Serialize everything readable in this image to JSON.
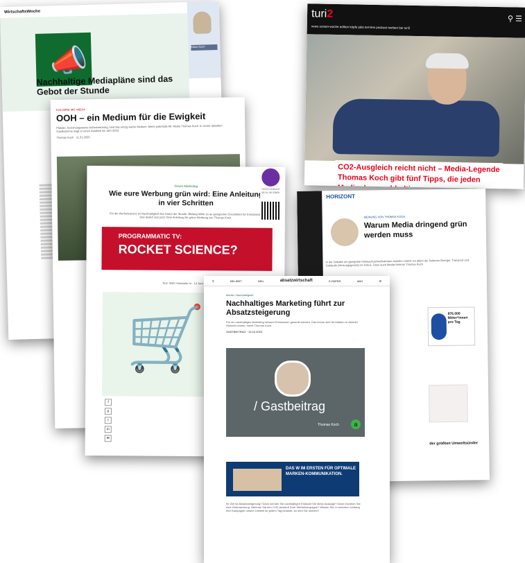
{
  "card_wiwo": {
    "masthead": "WirtschaftsWoche",
    "headline": "Nachhaltige Mediapläne sind das Gebot der Stunde",
    "side_caption": "Klaus Koch"
  },
  "card_turi2": {
    "logo_main": "turi",
    "logo_accent": "2",
    "nav": "news  screen-woche  edition  köpfe  jobs  termine  podcast  werben bei turi2",
    "headline": "CO2-Ausgleich reicht nicht – Media-Legende Thomas Koch gibt fünf Tipps, die jeden Mediaplan nachhaltiger"
  },
  "card_ooh": {
    "kicker": "KOLUMNE MR. MEDIA",
    "headline": "OOH – ein Medium für die Ewigkeit",
    "lead": "Plakate, beziehungsweise Außenwerbung, sind das einzig wahre Medium. Meint jedenfalls Mr. Media Thomas Koch. In seiner aktuellen Gastkolumne wagt er einen Ausblick ins Jahr 2023.",
    "byline": "Thomas Koch · 11.01.2023"
  },
  "card_green": {
    "kicker": "Green Marketing",
    "headline": "Wie eure Werbung grün wird: Eine Anleitung in vier Schritten",
    "lead": "Für die Werbebranche ist Nachhaltigkeit das Gebot der Stunde. Bislang fehlte es an geeigneten Checklisten für Entscheider. Das ändert sich jetzt: Eine Anleitung für grüne Werbung von Thomas Koch.",
    "ad_line1": "PROGRAMMATIC TV:",
    "ad_line2": "ROCKET SCIENCE?",
    "qr_caption": "TICKETVERKAUF AB 19. OKTOBER",
    "byline": "Text: W&V Gastautor·in · 14 Juni 2023"
  },
  "card_horizont": {
    "logo": "HORIZONT",
    "kicker": "MEINUNG VON THOMAS KOCH",
    "headline": "Warum Media dringend grün werden muss",
    "lead": "In der Debatte um geeignete Klimaschutzmaßnahmen standen zuletzt vor allem die Sektoren Energie, Transport und Gebäude (Heizungsgesetz) im Fokus. Dazu auch Media-Veteran Thomas Koch.",
    "ad_number": "876.000 Mitter*innen pro Tag",
    "section_heading": "der größten Umweltsünder"
  },
  "card_absatz": {
    "top_left": "BELIEBT",
    "top_mid": "NEU",
    "brand": "absatzwirtschaft",
    "top_right1": "E-PAPER",
    "top_right2": "ABO",
    "crumb": "Media / Nachhaltigkeit",
    "headline": "Nachhaltiges Marketing führt zur Absatzsteigerung",
    "lead": "Für ein nachhaltiges Marketing müssen Emissionen gesenkt werden. Das könne sich für Marken in vielerlei Hinsicht lohnen, meint Thomas Koch.",
    "meta": "GASTBEITRAG · 13.10.2023",
    "gastbeitrag": "/ Gastbeitrag",
    "author": "Thomas Koch",
    "badge": "a",
    "ad_text": "DAS W IM ERSTEN FÜR OPTIMALE MARKEN-KOMMUNIKATION.",
    "body": "Ihr Ziel ist Absatzsteigerung? Dann werden Sie nachhaltiger! Erstaunt Sie diese Aussage? Dann erwarten Sie eine Überraschung. Nehmen Sie den CO2-Ausstoß Ihrer Werbekampagne? Wissen Sie, in welchem Umfang Ihre Kampagne unsere Umwelt an jedem Tag belastet, an dem Sie werben?"
  }
}
